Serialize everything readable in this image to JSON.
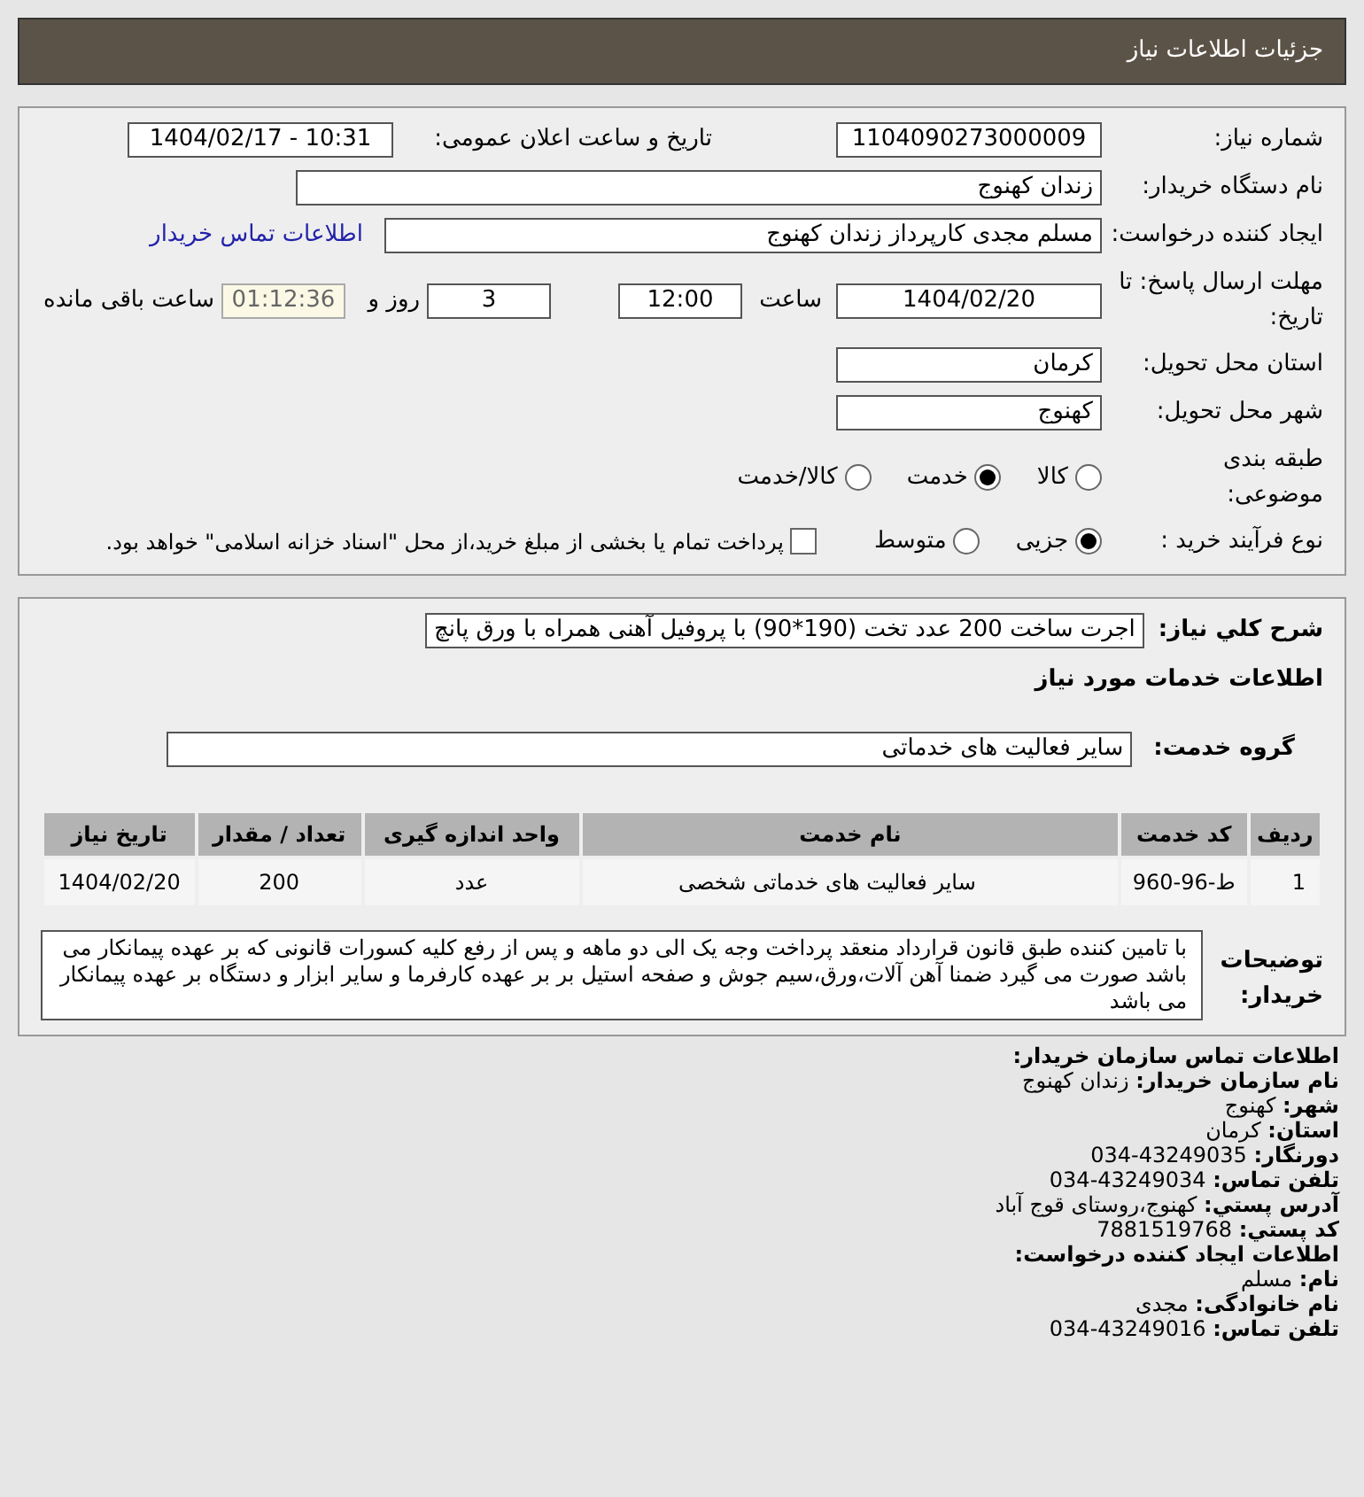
{
  "header": {
    "title": "جزئیات اطلاعات نیاز"
  },
  "fields": {
    "need_number": {
      "label": "شماره نیاز:",
      "value": "1104090273000009"
    },
    "announce": {
      "label": "تاریخ و ساعت اعلان عمومی:",
      "value": "1404/02/17 - 10:31"
    },
    "buyer": {
      "label": "نام دستگاه خریدار:",
      "value": "زندان کهنوج"
    },
    "creator": {
      "label": "ایجاد کننده درخواست:",
      "value": "مسلم مجدی کارپرداز زندان کهنوج",
      "link": "اطلاعات تماس خریدار"
    },
    "deadline": {
      "label": "مهلت ارسال پاسخ: تا تاریخ:",
      "date": "1404/02/20",
      "time_label": "ساعت",
      "time": "12:00",
      "days": "3",
      "days_label": "روز و",
      "remaining": "01:12:36",
      "remaining_label": "ساعت باقی مانده"
    },
    "province": {
      "label": "استان محل تحویل:",
      "value": "کرمان"
    },
    "city": {
      "label": "شهر محل تحویل:",
      "value": "کهنوج"
    },
    "category": {
      "label": "طبقه بندی موضوعی:",
      "options": [
        {
          "label": "کالا",
          "selected": false
        },
        {
          "label": "خدمت",
          "selected": true
        },
        {
          "label": "کالا/خدمت",
          "selected": false
        }
      ]
    },
    "process": {
      "label": "نوع فرآیند خرید :",
      "options": [
        {
          "label": "جزیی",
          "selected": true
        },
        {
          "label": "متوسط",
          "selected": false
        }
      ],
      "checkbox": {
        "label": "پرداخت تمام یا بخشی از مبلغ خرید،از محل \"اسناد خزانه اسلامی\" خواهد بود.",
        "checked": false
      }
    }
  },
  "summary": {
    "label": "شرح كلي نياز:",
    "value": "اجرت ساخت 200 عدد تخت (190*90) با پروفیل آهنی همراه با ورق پانچ"
  },
  "services_title": "اطلاعات خدمات مورد نیاز",
  "service_group": {
    "label": "گروه خدمت:",
    "value": "سایر فعالیت های خدماتی"
  },
  "table": {
    "columns": [
      "ردیف",
      "کد خدمت",
      "نام خدمت",
      "واحد اندازه گیری",
      "تعداد / مقدار",
      "تاریخ نیاز"
    ],
    "rows": [
      [
        "1",
        "ط-96-960",
        "سایر فعالیت های خدماتی شخصی",
        "عدد",
        "200",
        "1404/02/20"
      ]
    ]
  },
  "notes": {
    "label": "توضیحات خریدار:",
    "value": "با تامین کننده طبق قانون قرارداد منعقد پرداخت وجه یک الی دو ماهه و پس از رفع کلیه کسورات قانونی که بر عهده پیمانکار می باشد صورت می گیرد ضمنا آهن آلات،ورق،سیم جوش و صفحه استیل بر بر عهده کارفرما و سایر ابزار و دستگاه بر عهده پیمانکار می باشد"
  },
  "contact": [
    "**اطلاعات تماس سازمان خریدار:**",
    "**نام سازمان خریدار:** زندان کهنوج",
    "**شهر:** کهنوج",
    "**استان:** کرمان",
    "**دورنگار:** 43249035-034",
    "**تلفن تماس:** 43249034-034",
    "**آدرس پستي:** کهنوج،روستای قوج آباد",
    "**کد پستي:** 7881519768",
    "**اطلاعات ایجاد کننده درخواست:**",
    "**نام:** مسلم",
    "**نام خانوادگی:** مجدی",
    "**تلفن تماس:** 43249016-034"
  ]
}
